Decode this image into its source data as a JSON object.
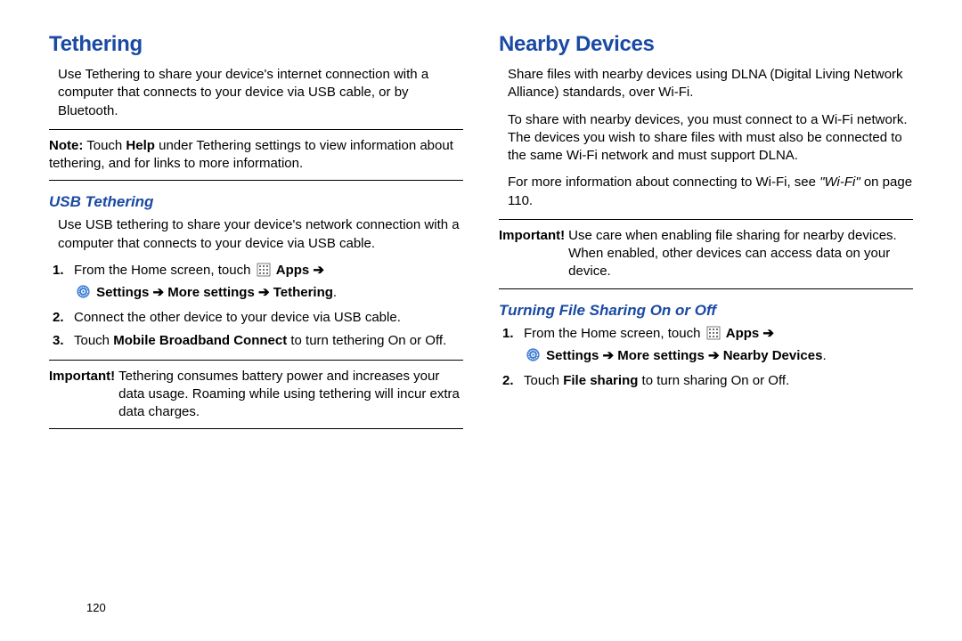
{
  "left": {
    "h2": "Tethering",
    "intro": "Use Tethering to share your device's internet connection with a computer that connects to your device via USB cable, or by Bluetooth.",
    "note_lead": "Note:",
    "note_body": " Touch ",
    "note_help": "Help",
    "note_rest": " under Tethering settings to view information about tethering, and for links to more information.",
    "h3": "USB Tethering",
    "usb_intro": "Use USB tethering to share your device's network connection with a computer that connects to your device via USB cable.",
    "step1_a": "From the Home screen, touch ",
    "apps_label": "Apps",
    "arrow": " ➔ ",
    "settings_label": "Settings",
    "more_settings_label": "More settings",
    "tethering_label": "Tethering",
    "period": ".",
    "step2": "Connect the other device to your device via USB cable.",
    "step3_a": "Touch ",
    "step3_bold": "Mobile Broadband Connect",
    "step3_b": " to turn tethering On or Off.",
    "imp_lead": "Important!",
    "imp_body": "Tethering consumes battery power and increases your data usage. Roaming while using tethering will incur extra data charges."
  },
  "right": {
    "h2": "Nearby Devices",
    "intro": "Share files with nearby devices using DLNA (Digital Living Network Alliance) standards, over Wi-Fi.",
    "p2": "To share with nearby devices, you must connect to a Wi-Fi network. The devices you wish to share files with must also be connected to the same Wi-Fi network and must support DLNA.",
    "p3_a": "For more information about connecting to Wi-Fi, see ",
    "p3_ref": "\"Wi-Fi\"",
    "p3_b": " on page 110.",
    "imp_lead": "Important!",
    "imp_body": "Use care when enabling file sharing for nearby devices. When enabled, other devices can access data on your device.",
    "h3": "Turning File Sharing On or Off",
    "step1_a": "From the Home screen, touch ",
    "apps_label": "Apps",
    "arrow": " ➔ ",
    "settings_label": "Settings",
    "more_settings_label": "More settings",
    "nearby_label": "Nearby Devices",
    "period": ".",
    "step2_a": "Touch ",
    "step2_bold": "File sharing",
    "step2_b": " to turn sharing On or Off."
  },
  "page_num": "120"
}
